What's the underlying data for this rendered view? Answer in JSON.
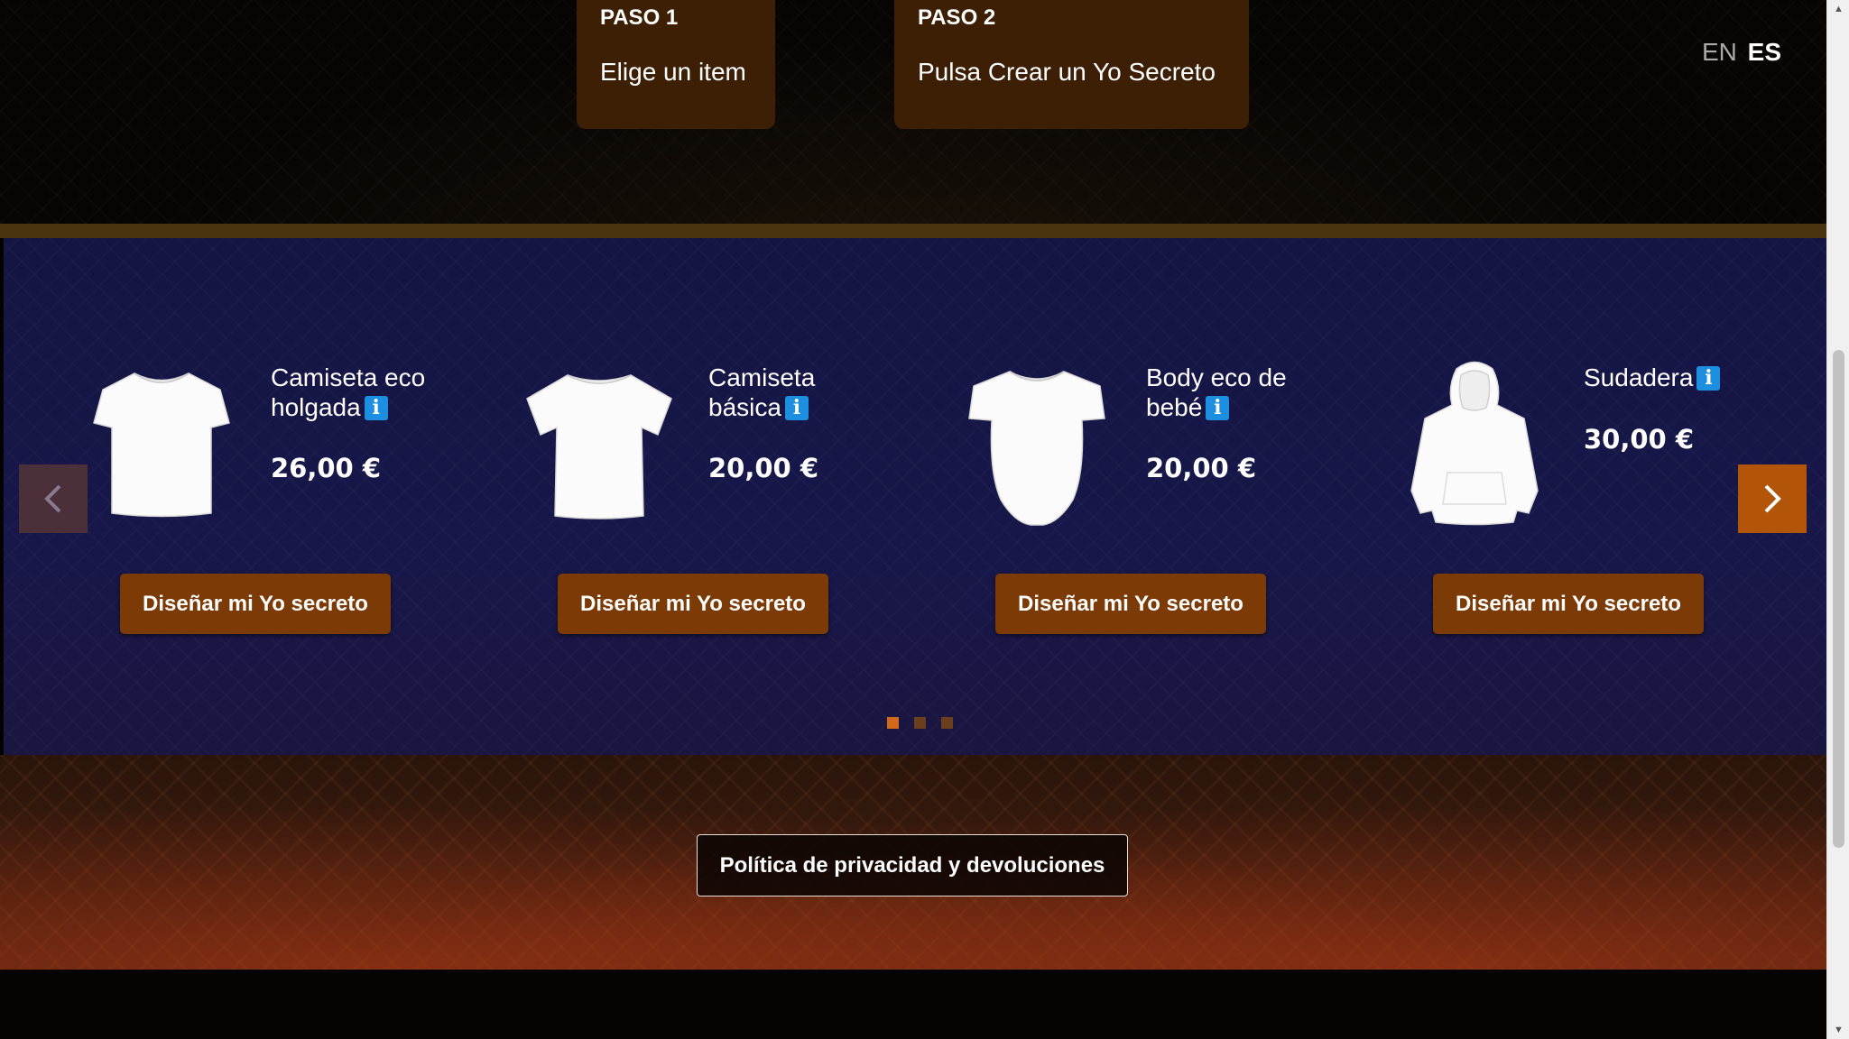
{
  "steps": [
    {
      "label": "PASO 1",
      "text": "Elige un item"
    },
    {
      "label": "PASO 2",
      "text": "Pulsa Crear un Yo Secreto"
    }
  ],
  "language": {
    "options": [
      "EN",
      "ES"
    ],
    "active": "ES"
  },
  "products": [
    {
      "title": "Camiseta eco holgada",
      "price": "26,00 €",
      "button": "Diseñar mi Yo secreto",
      "image": "tshirt-relaxed-icon"
    },
    {
      "title": "Camiseta básica",
      "price": "20,00 €",
      "button": "Diseñar mi Yo secreto",
      "image": "tshirt-basic-icon"
    },
    {
      "title": "Body eco de bebé",
      "price": "20,00 €",
      "button": "Diseñar mi Yo secreto",
      "image": "baby-bodysuit-icon"
    },
    {
      "title": "Sudadera",
      "price": "30,00 €",
      "button": "Diseñar mi Yo secreto",
      "image": "hoodie-icon"
    }
  ],
  "info_badge": "i",
  "carousel": {
    "pages": 3,
    "active_page": 1
  },
  "footer": {
    "policy_button": "Política de privacidad y devoluciones"
  },
  "colors": {
    "accent": "#7b3a06",
    "step_bg": "#3d1f05",
    "carousel_bg": "#17174a",
    "info": "#1d8fe0",
    "arrow_active": "#b35508"
  }
}
